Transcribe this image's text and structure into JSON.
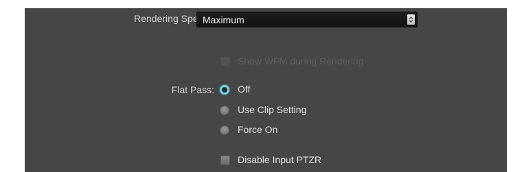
{
  "rendering_speed": {
    "label": "Rendering Speed:",
    "value": "Maximum"
  },
  "show_wfm": {
    "label": "Show WFM during Rendering",
    "checked": false,
    "enabled": false
  },
  "flat_pass": {
    "label": "Flat Pass:",
    "options": [
      {
        "label": "Off",
        "selected": true
      },
      {
        "label": "Use Clip Setting",
        "selected": false
      },
      {
        "label": "Force On",
        "selected": false
      }
    ]
  },
  "disable_input_ptzr": {
    "label": "Disable Input PTZR",
    "checked": false
  },
  "colors": {
    "panel_bg": "#464646",
    "radio_accent": "#6fd2e6"
  }
}
